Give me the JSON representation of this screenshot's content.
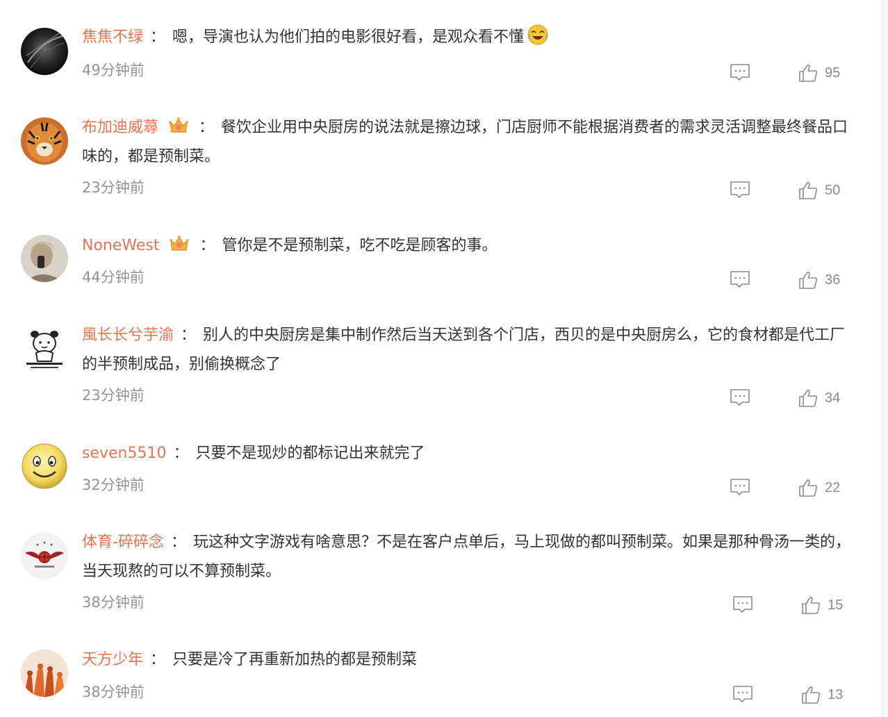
{
  "colors": {
    "username": "#eb7350",
    "text": "#333333",
    "muted": "#939393"
  },
  "comments": [
    {
      "user": "焦焦不绿",
      "badge": "none",
      "emoji": "laughing-tears-icon",
      "text": "嗯，导演也认为他们拍的电影很好看，是观众看不懂",
      "time": "49分钟前",
      "likes": "95",
      "avatar": "dark-feather-avatar"
    },
    {
      "user": "布加迪威蕁",
      "badge": "crown-icon",
      "text": "餐饮企业用中央厨房的说法就是擦边球，门店厨师不能根据消费者的需求灵活调整最终餐品口味的，都是预制菜。",
      "time": "23分钟前",
      "likes": "50",
      "avatar": "tiger-avatar"
    },
    {
      "user": "NoneWest",
      "badge": "crown-icon",
      "text": "管你是不是预制菜，吃不吃是顾客的事。",
      "time": "44分钟前",
      "likes": "36",
      "avatar": "photo-avatar"
    },
    {
      "user": "風长长兮芋渝",
      "badge": "none",
      "text": "别人的中央厨房是集中制作然后当天送到各个门店，西贝的是中央厨房么，它的食材都是代工厂的半预制成品，别偷换概念了",
      "time": "23分钟前",
      "likes": "34",
      "avatar": "cartoon-avatar"
    },
    {
      "user": "seven5510",
      "badge": "none",
      "text": "只要不是现炒的都标记出来就完了",
      "time": "32分钟前",
      "likes": "22",
      "avatar": "smiley-avatar"
    },
    {
      "user": "体育-碎碎念",
      "badge": "none",
      "text": "玩这种文字游戏有啥意思？不是在客户点单后，马上现做的都叫预制菜。如果是那种骨汤一类的，当天现熬的可以不算预制菜。",
      "time": "38分钟前",
      "likes": "15",
      "avatar": "sports-logo-avatar"
    },
    {
      "user": "天方少年",
      "badge": "none",
      "text": "只要是冷了再重新加热的都是预制菜",
      "time": "38分钟前",
      "likes": "13",
      "avatar": "silhouettes-avatar"
    }
  ],
  "separator": "："
}
